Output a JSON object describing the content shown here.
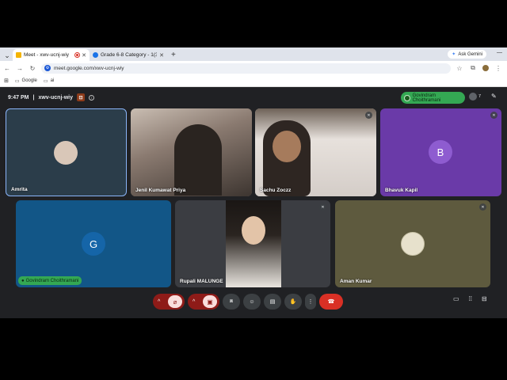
{
  "browser": {
    "tabs": [
      {
        "label": "Meet - xwv-ucnj-wiy",
        "active": true
      },
      {
        "label": "Grade 6-8 Category - 1(34+ ...",
        "active": false
      }
    ],
    "ask_gemini": "Ask Gemini",
    "url": "meet.google.com/xwv-ucnj-wiy",
    "bookmarks": [
      "Google",
      "ai"
    ]
  },
  "meeting": {
    "time": "9:47 PM",
    "code": "xwv-ucnj-wiy",
    "presenter": "Govindram Choithramani",
    "participant_count": "7",
    "participants": [
      {
        "name": "Amrita",
        "muted": false
      },
      {
        "name": "Jenil Kumawat Priya",
        "muted": false
      },
      {
        "name": "Sachu Zoczz",
        "muted": true
      },
      {
        "name": "Bhavuk Kapil",
        "muted": true,
        "initial": "B"
      },
      {
        "name": "Govindram Choithramani",
        "initial": "G"
      },
      {
        "name": "Rupali MALUNGE",
        "muted": true
      },
      {
        "name": "Aman Kumar",
        "muted": true
      }
    ]
  },
  "colors": {
    "meet_bg": "#202124",
    "tile_amrita": "#2b3d4a",
    "tile_bhavuk": "#6a3aa8",
    "tile_govind": "#125687",
    "tile_rupali": "#3b3d42",
    "tile_aman": "#5e5a3e",
    "end_call": "#d93025",
    "presenter_green": "#34a853"
  }
}
